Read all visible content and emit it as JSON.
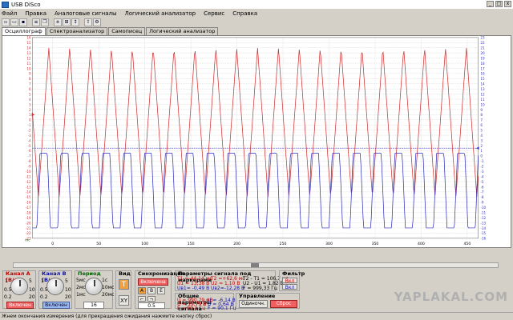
{
  "window": {
    "title": "USB DiSco"
  },
  "menu": [
    "Файл",
    "Правка",
    "Аналоговые сигналы",
    "Логический анализатор",
    "Сервис",
    "Справка"
  ],
  "tabs": [
    "Осциллограф",
    "Спектроанализатор",
    "Самописец",
    "Логический анализатор"
  ],
  "active_tab": "Осциллограф",
  "chart_data": {
    "type": "line",
    "x": {
      "ticks": [
        0,
        50,
        100,
        150,
        200,
        250,
        300,
        350,
        400,
        450
      ],
      "range": [
        -22,
        462
      ]
    },
    "y_left": {
      "ticks": [
        16,
        15,
        14,
        13,
        12,
        11,
        10,
        9,
        8,
        7,
        6,
        5,
        4,
        3,
        2,
        1,
        0,
        -1,
        -2,
        -3,
        -4,
        -5,
        -6,
        -7,
        -8,
        -9,
        -10,
        -11,
        -12,
        -13,
        -14,
        -15,
        -16,
        -17,
        -18,
        -19,
        -20,
        -21,
        -22,
        -23
      ],
      "range": [
        -23,
        16
      ],
      "color": "#d03030"
    },
    "y_right": {
      "ticks": [
        23,
        22,
        21,
        20,
        19,
        18,
        17,
        16,
        15,
        14,
        13,
        12,
        11,
        10,
        9,
        8,
        7,
        6,
        5,
        4,
        3,
        2,
        1,
        0,
        -1,
        -2,
        -3,
        -4,
        -5,
        -6,
        -7,
        -8,
        -9,
        -10,
        -11,
        -12,
        -13,
        -14,
        -15,
        -16
      ],
      "range": [
        -16,
        23
      ],
      "color": "#3030c0"
    },
    "series": [
      {
        "channel": "A",
        "color": "#d03030",
        "shape": "triangle",
        "min": -15,
        "max": 14,
        "periods": 21
      },
      {
        "channel": "B",
        "color": "#3030c0",
        "shape": "square-ish",
        "min": -21,
        "max": -6.5,
        "periods": 21
      }
    ],
    "cursor_level": -5.5,
    "grid": true,
    "x_unit_label": "mc"
  },
  "controls": {
    "channel_a": {
      "title": "Канал A (В/л)",
      "btn": "Включен",
      "v1": "1",
      "v2": "5",
      "v3": "0.5",
      "v4": "10",
      "v5": "0.2",
      "v6": "20"
    },
    "channel_b": {
      "title": "Канал B (В/л)",
      "btn": "Включен",
      "v1": "1",
      "v2": "5",
      "v3": "0.5",
      "v4": "10",
      "v5": "0.2",
      "v6": "20"
    },
    "period": {
      "title": "Период",
      "v1": "5мс",
      "v2": "2мс",
      "v3": "1мс",
      "v4": "1с",
      "v5": "10мс",
      "v6": "20мс",
      "v7": "50мс",
      "value": "16"
    },
    "view": {
      "title": "Вид",
      "t_btn": "T",
      "xy_btn": "XY"
    },
    "sync": {
      "title": "Синхронизация",
      "btn": "Включена",
      "a": "A",
      "b": "B",
      "e": "E",
      "level": "0.5"
    },
    "markers": {
      "title": "Параметры сигнала под маркерами",
      "t1": "T1 =-44,14 мс",
      "u1": "U1 = 13,38 В",
      "ub1": "Uв1= -0,49 В",
      "t2": "T2 =+62,6 мс",
      "u2": "U2 = 1,10 В",
      "ub2": "Uв2=-12,28 В",
      "dt": "T2 - T1 = 106,7 мс",
      "du": "U2 - U1 = 1,82 В",
      "f": "F = 999,33 Гц"
    },
    "general": {
      "title": "Общие параметры сигнала",
      "u1": "U = 990,79 мВ",
      "u2": "U = -6,14 В",
      "u3": "U = 19,79 В",
      "u4": "U = 0,64 В",
      "f1": "F = 90,1 Гц",
      "f2": "F = 90,1 Гц"
    },
    "manage": {
      "title": "Управление",
      "single": "Одиночн.",
      "reset": "Сброс"
    },
    "filter": {
      "title": "Фильтр",
      "btn_a": "Вкл",
      "btn_b": "Вкл"
    }
  },
  "status": "Жнем окончания измерения (для прекращения ожидания нажмите кнопку сброс)",
  "watermark": "YAPLAKAL.COM"
}
